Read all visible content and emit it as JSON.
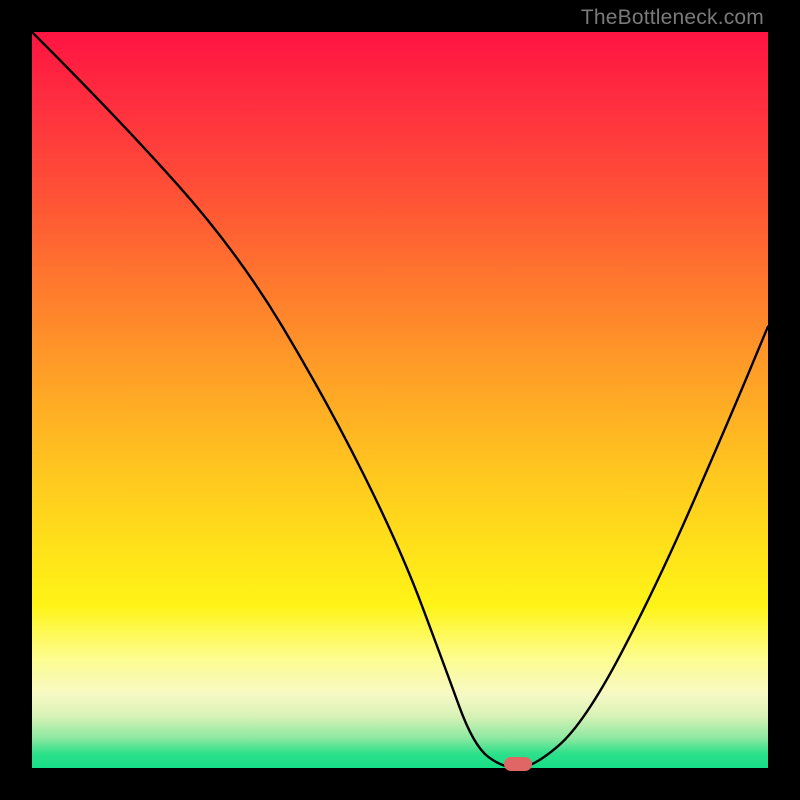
{
  "watermark": "TheBottleneck.com",
  "chart_data": {
    "type": "line",
    "title": "",
    "xlabel": "",
    "ylabel": "",
    "xlim": [
      0,
      100
    ],
    "ylim": [
      0,
      100
    ],
    "grid": false,
    "series": [
      {
        "name": "bottleneck-curve",
        "x": [
          0,
          12,
          28,
          40,
          50,
          56,
          60,
          64,
          68,
          75,
          85,
          95,
          100
        ],
        "values": [
          100,
          88,
          70,
          50,
          30,
          14,
          3,
          0,
          0,
          6,
          25,
          48,
          60
        ]
      }
    ],
    "marker": {
      "x": 66,
      "y": 0
    },
    "background_gradient": {
      "top": "#ff1442",
      "mid": "#ffd21a",
      "bottom": "#14df87"
    }
  }
}
